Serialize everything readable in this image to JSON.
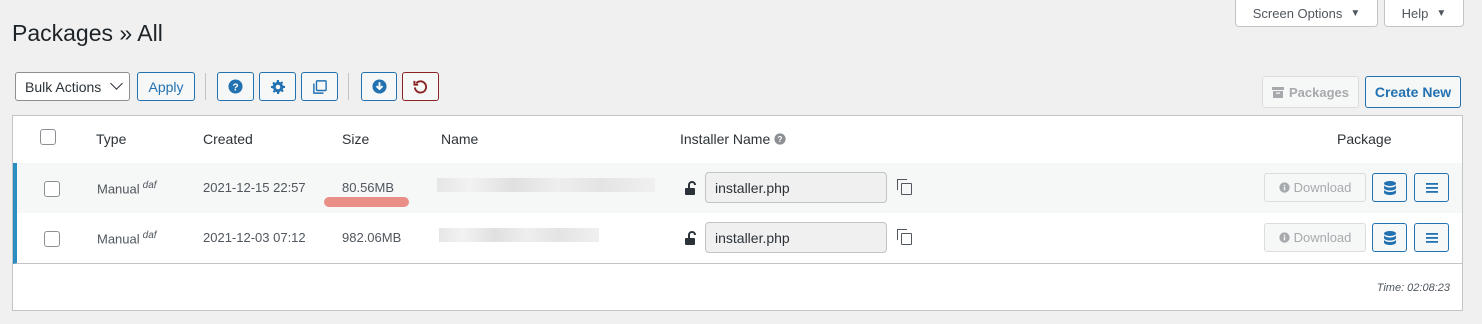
{
  "header": {
    "screen_options_label": "Screen Options",
    "help_label": "Help",
    "title": "Packages » All"
  },
  "toolbar": {
    "bulk_actions": "Bulk Actions",
    "apply_label": "Apply",
    "packages_label": "Packages",
    "create_new_label": "Create New"
  },
  "table": {
    "columns": {
      "type": "Type",
      "created": "Created",
      "size": "Size",
      "name": "Name",
      "installer_name": "Installer Name",
      "package": "Package"
    },
    "rows": [
      {
        "type": "Manual",
        "type_sup": "daf",
        "created": "2021-12-15 22:57",
        "size": "80.56MB",
        "installer": "installer.php",
        "download_label": "Download"
      },
      {
        "type": "Manual",
        "type_sup": "daf",
        "created": "2021-12-03 07:12",
        "size": "982.06MB",
        "installer": "installer.php",
        "download_label": "Download"
      }
    ],
    "time": "Time: 02:08:23"
  },
  "colors": {
    "accent": "#2271b1",
    "row_marker": "#2a8fc0",
    "undo_red": "#8a2424",
    "highlight": "#e98f88"
  },
  "icons": [
    "question-icon",
    "gear-icon",
    "copy-icon",
    "download-circle-icon",
    "undo-icon",
    "archive-icon",
    "lock-icon",
    "database-icon",
    "menu-icon",
    "info-icon"
  ]
}
